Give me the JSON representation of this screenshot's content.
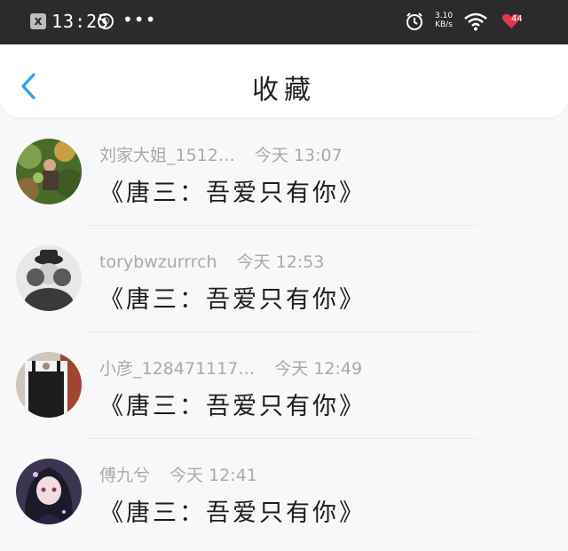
{
  "status_bar": {
    "close_glyph": "x",
    "time": "13:25",
    "dots": "•••",
    "net_speed_value": "3.10",
    "net_speed_unit": "KB/s",
    "battery": "44"
  },
  "header": {
    "title": "收藏"
  },
  "favorites": [
    {
      "username": "刘家大姐_1512…",
      "time": "今天 13:07",
      "title": "《唐三：吾爱只有你》"
    },
    {
      "username": "torybwzurrrch",
      "time": "今天 12:53",
      "title": "《唐三：吾爱只有你》"
    },
    {
      "username": "小彦_128471117…",
      "time": "今天 12:49",
      "title": "《唐三：吾爱只有你》"
    },
    {
      "username": "傅九兮",
      "time": "今天 12:41",
      "title": "《唐三：吾爱只有你》"
    }
  ],
  "colors": {
    "accent": "#2d9ff0",
    "status_bar_bg": "#2b2b2b",
    "meta_text": "#a9a9a9",
    "battery_heart": "#e0394a"
  }
}
